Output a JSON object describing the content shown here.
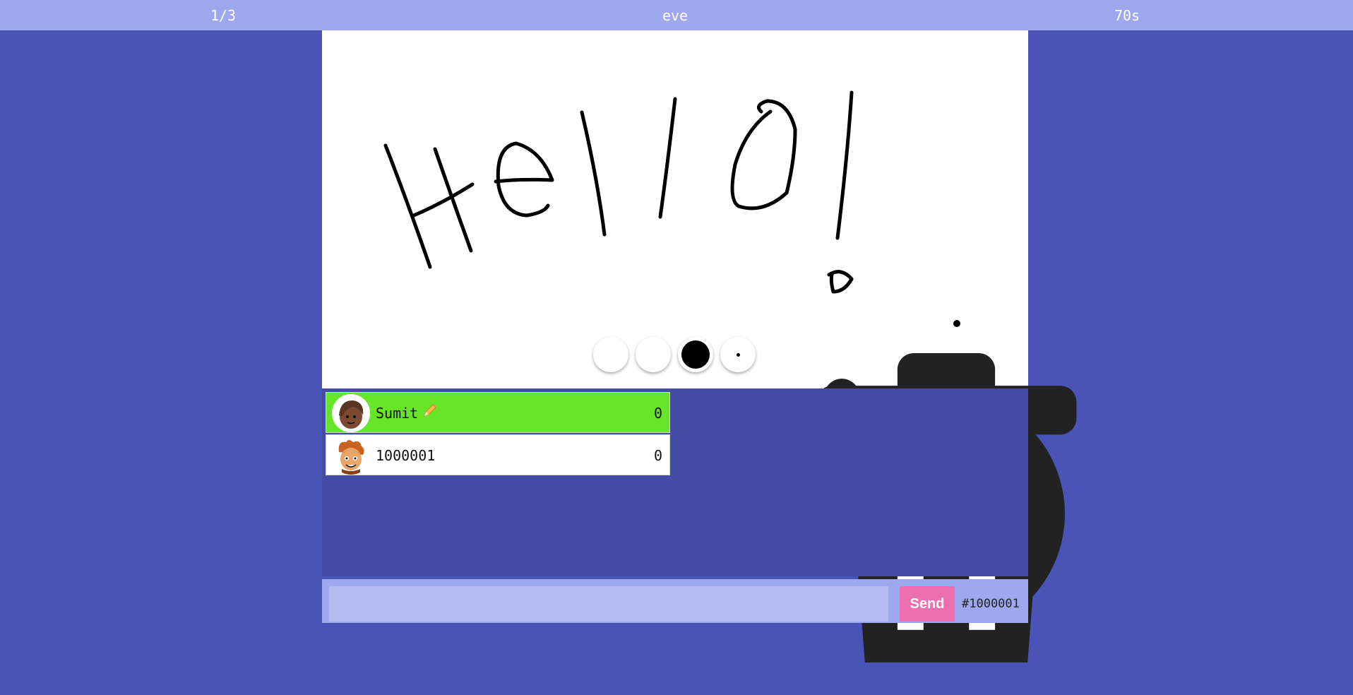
{
  "header": {
    "round": "1/3",
    "word": "eve",
    "timer": "70s"
  },
  "canvas": {
    "drawing_text": "Hello!",
    "tools": [
      {
        "icon": "undo-icon"
      },
      {
        "icon": "trash-icon"
      },
      {
        "icon": "color-swatch",
        "color": "#000000"
      },
      {
        "icon": "brush-size-small"
      }
    ]
  },
  "players": [
    {
      "name": "Sumit",
      "score": "0",
      "is_drawing": true,
      "avatar": "brown-hair-avatar"
    },
    {
      "name": "1000001",
      "score": "0",
      "is_drawing": false,
      "avatar": "orange-hair-avatar"
    }
  ],
  "chat": {
    "placeholder": "",
    "send_label": "Send",
    "room_id": "#1000001"
  },
  "colors": {
    "background": "#4a53b6",
    "topbar": "#9ea8ee",
    "drawer_highlight": "#66e529",
    "send_button": "#ec6fb0"
  }
}
